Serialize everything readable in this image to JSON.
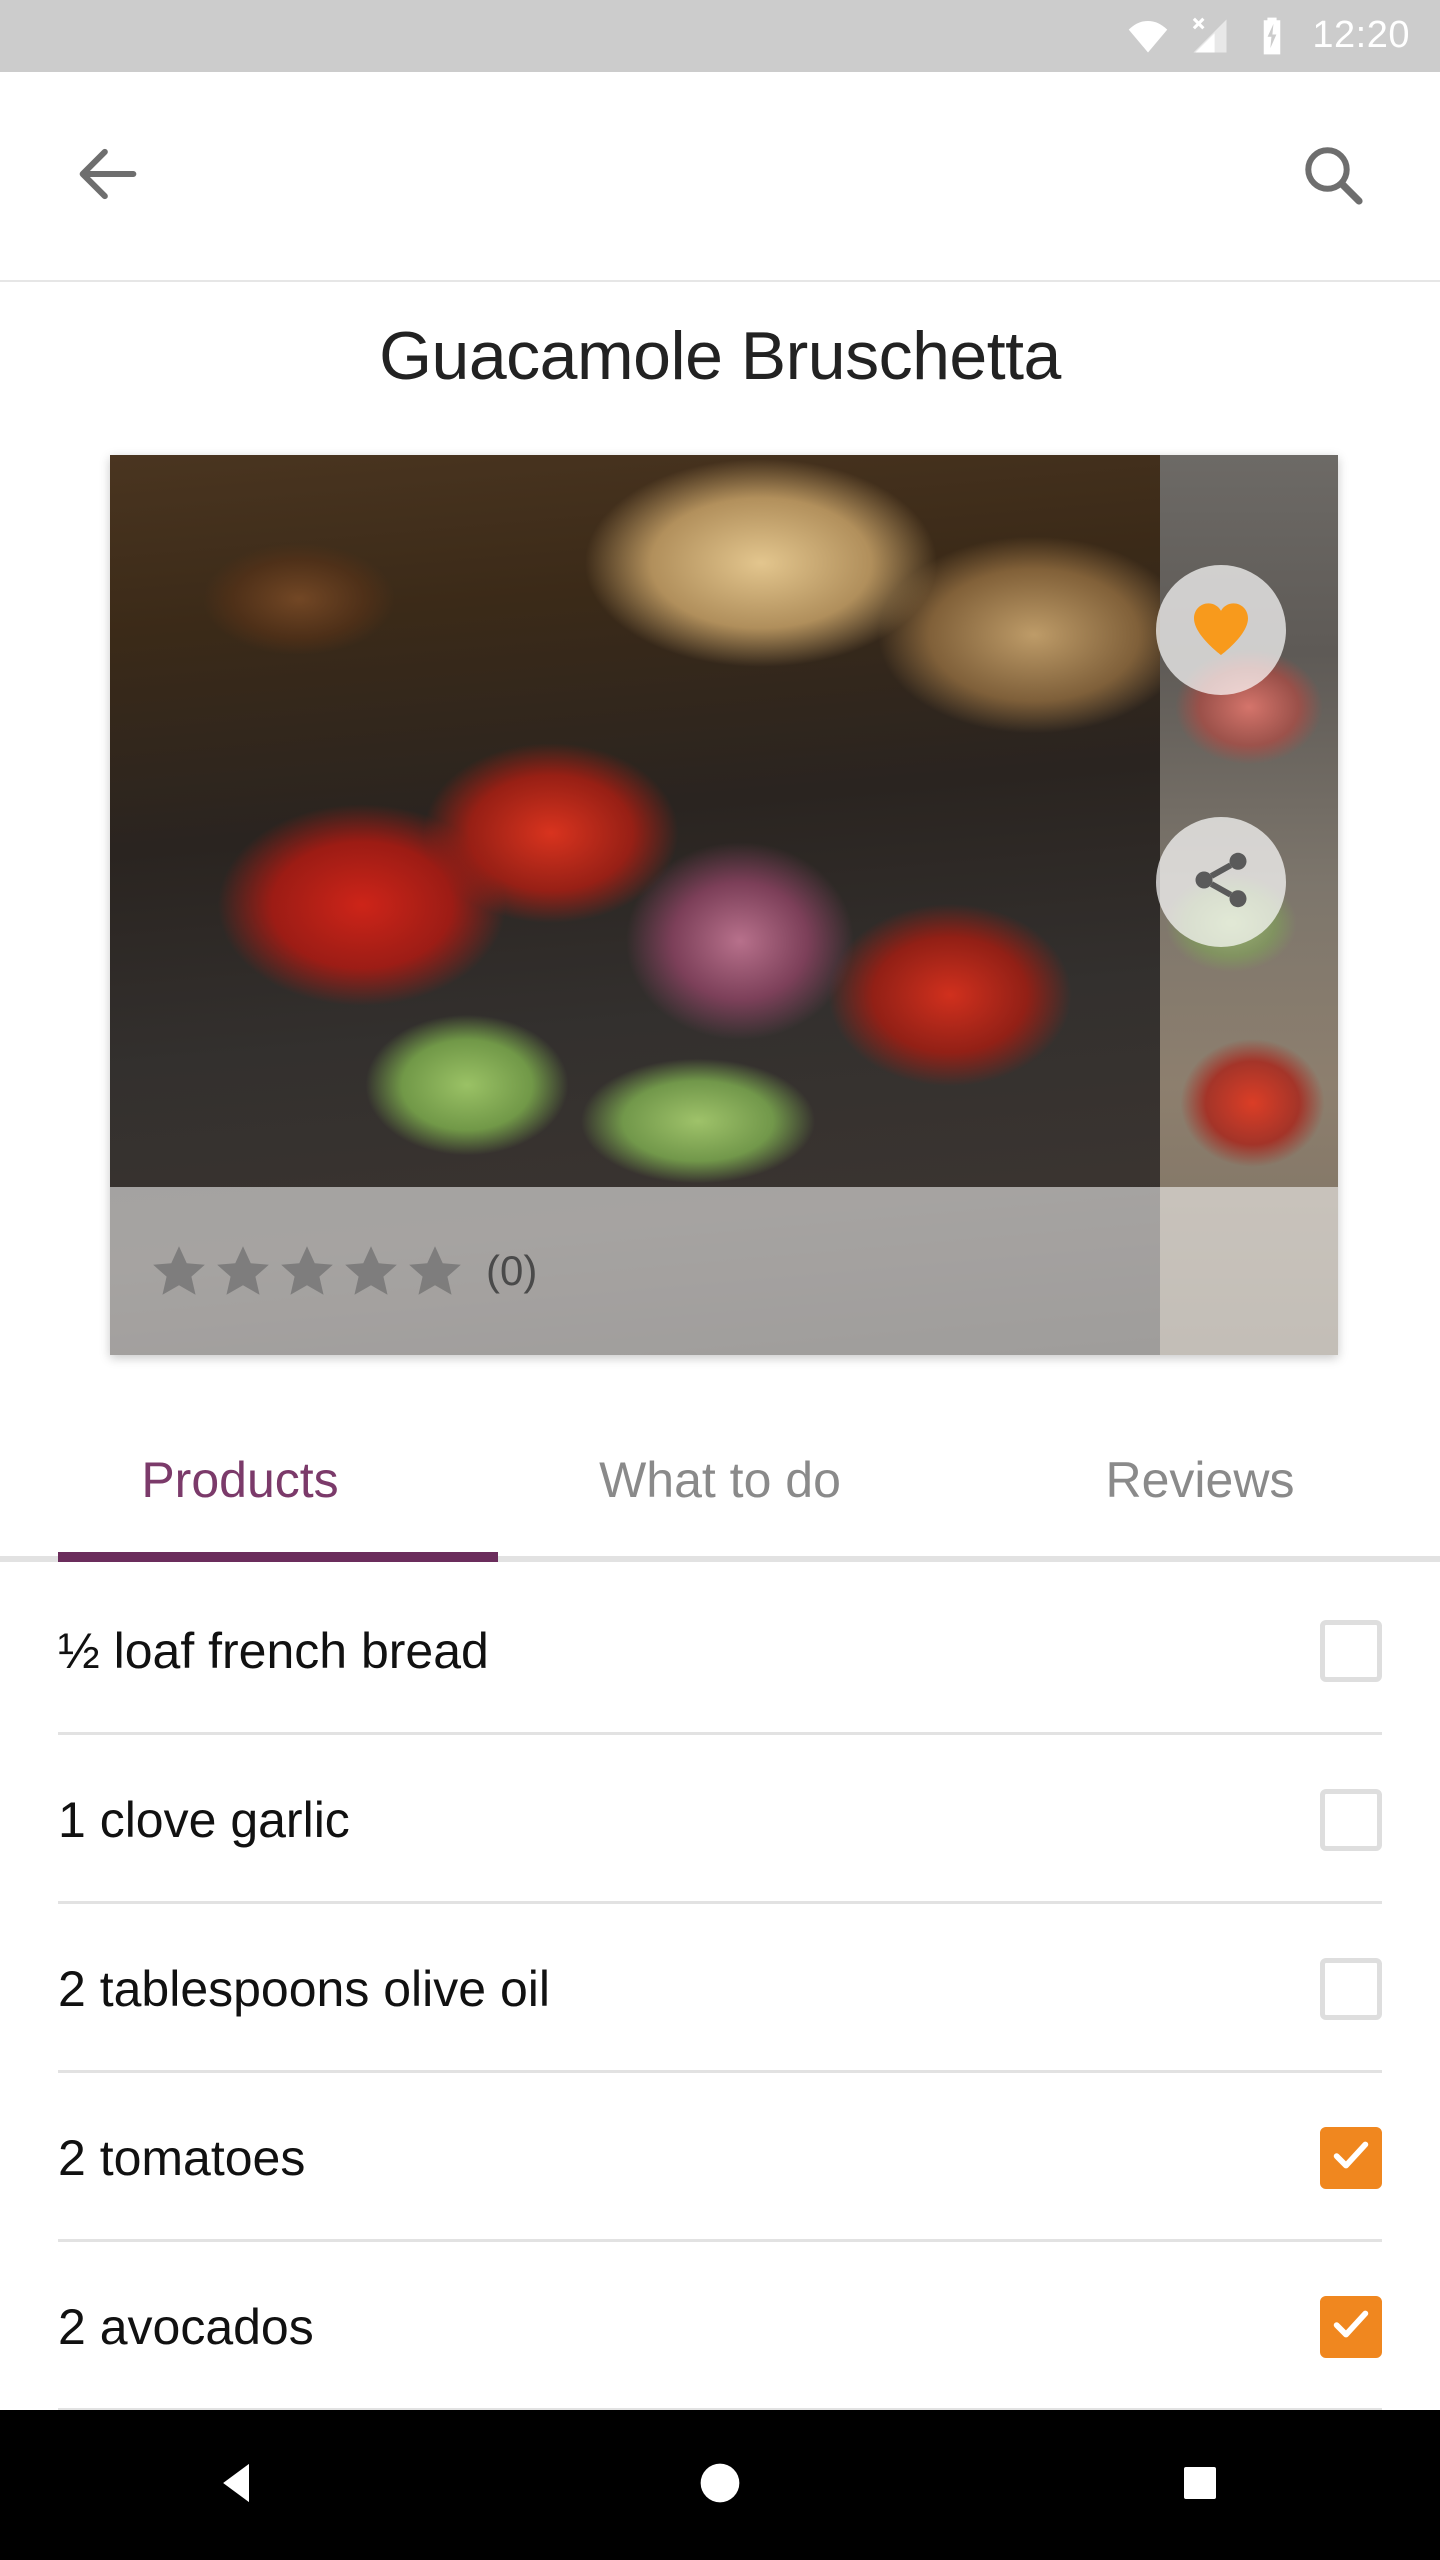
{
  "statusbar": {
    "time": "12:20",
    "icons": [
      "wifi-icon",
      "cellular-no-sim-icon",
      "battery-charging-icon"
    ]
  },
  "appbar": {
    "back_icon": "back-arrow-icon",
    "search_icon": "search-icon"
  },
  "recipe": {
    "title": "Guacamole Bruschetta",
    "favorite_icon": "heart-filled-icon",
    "favorite_active": true,
    "share_icon": "share-icon",
    "rating": {
      "stars_total": 5,
      "stars_filled": 0,
      "count_label": "(0)"
    }
  },
  "tabs": [
    {
      "label": "Products",
      "active": true
    },
    {
      "label": "What to do",
      "active": false
    },
    {
      "label": "Reviews",
      "active": false
    }
  ],
  "products": [
    {
      "label": "½ loaf french bread",
      "checked": false
    },
    {
      "label": "1 clove garlic",
      "checked": false
    },
    {
      "label": "2 tablespoons olive oil",
      "checked": false
    },
    {
      "label": "2 tomatoes",
      "checked": true
    },
    {
      "label": "2 avocados",
      "checked": true
    }
  ],
  "navbar": {
    "back": "nav-back-icon",
    "home": "nav-home-icon",
    "recents": "nav-recents-icon"
  },
  "colors": {
    "accent_orange": "#f0871f",
    "accent_purple": "#6b2d5c",
    "tab_active_text": "#7b3a6a",
    "statusbar_bg": "#cccccc",
    "divider": "#e2e2e2"
  }
}
